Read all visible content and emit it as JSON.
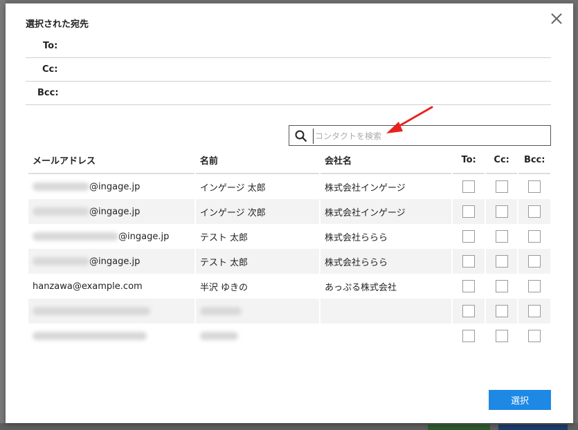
{
  "dialog": {
    "title": "選択された宛先",
    "close_label": "×"
  },
  "recipients": {
    "to_label": "To:",
    "cc_label": "Cc:",
    "bcc_label": "Bcc:"
  },
  "search": {
    "placeholder": "コンタクトを検索",
    "value": ""
  },
  "table": {
    "headers": {
      "email": "メールアドレス",
      "name": "名前",
      "company": "会社名",
      "to": "To:",
      "cc": "Cc:",
      "bcc": "Bcc:"
    },
    "rows": [
      {
        "email": "@ingage.jp",
        "name": "インゲージ 太郎",
        "company": "株式会社インゲージ"
      },
      {
        "email": "@ingage.jp",
        "name": "インゲージ 次郎",
        "company": "株式会社インゲージ"
      },
      {
        "email": "@ingage.jp",
        "name": "テスト 太郎",
        "company": "株式会社ららら"
      },
      {
        "email": "@ingage.jp",
        "name": "テスト 太郎",
        "company": "株式会社ららら"
      },
      {
        "email": "hanzawa@example.com",
        "name": "半沢 ゆきの",
        "company": "あっぷる株式会社"
      },
      {
        "email": "",
        "name": "",
        "company": ""
      },
      {
        "email": "",
        "name": "",
        "company": ""
      }
    ]
  },
  "footer": {
    "select_label": "選択"
  },
  "colors": {
    "accent": "#1e88e5",
    "annotation_arrow": "#e8231f"
  }
}
